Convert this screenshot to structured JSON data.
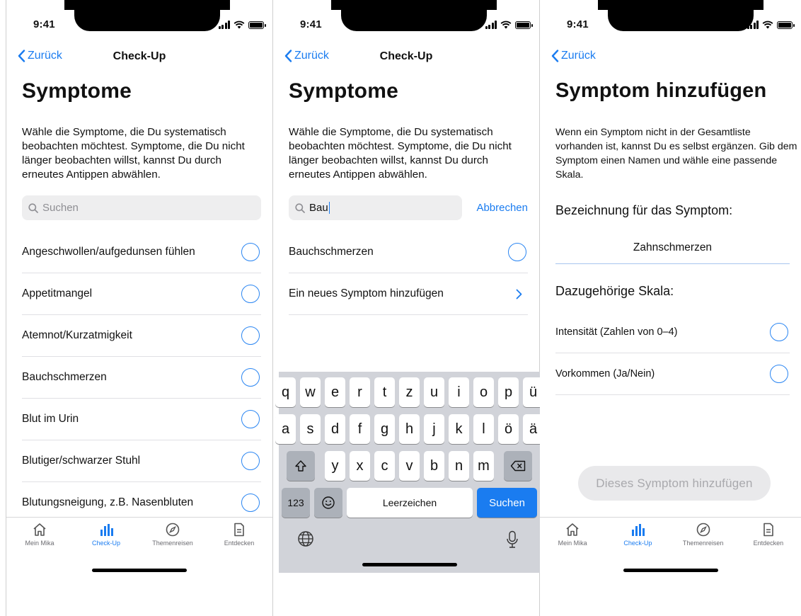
{
  "status": {
    "time": "9:41"
  },
  "screen1": {
    "back_label": "Zurück",
    "nav_title": "Check-Up",
    "title": "Symptome",
    "description": "Wähle die Symptome, die Du systematisch beobachten möchtest. Symptome, die Du nicht länger beobachten willst, kannst Du durch erneutes Antippen abwählen.",
    "search_placeholder": "Suchen",
    "items": [
      {
        "label": "Angeschwollen/aufgedunsen fühlen"
      },
      {
        "label": "Appetitmangel"
      },
      {
        "label": "Atemnot/Kurzatmigkeit"
      },
      {
        "label": "Bauchschmerzen"
      },
      {
        "label": "Blut im Urin"
      },
      {
        "label": "Blutiger/schwarzer Stuhl"
      },
      {
        "label": "Blutungsneigung, z.B. Nasenbluten"
      }
    ]
  },
  "screen2": {
    "back_label": "Zurück",
    "nav_title": "Check-Up",
    "title": "Symptome",
    "description": "Wähle die Symptome, die Du systematisch beobachten möchtest. Symptome, die Du nicht länger beobachten willst, kannst Du durch erneutes Antippen abwählen.",
    "search_value": "Bau",
    "cancel_label": "Abbrechen",
    "result_item": "Bauchschmerzen",
    "add_new_item": "Ein neues Symptom hinzufügen",
    "keyboard": {
      "row1": [
        "q",
        "w",
        "e",
        "r",
        "t",
        "z",
        "u",
        "i",
        "o",
        "p",
        "ü"
      ],
      "row2": [
        "a",
        "s",
        "d",
        "f",
        "g",
        "h",
        "j",
        "k",
        "l",
        "ö",
        "ä"
      ],
      "row3": [
        "y",
        "x",
        "c",
        "v",
        "b",
        "n",
        "m"
      ],
      "numbers_key": "123",
      "space_key": "Leerzeichen",
      "search_key": "Suchen"
    }
  },
  "screen3": {
    "back_label": "Zurück",
    "title": "Symptom hinzufügen",
    "description": "Wenn ein Symptom nicht in der Gesamtliste vorhanden ist, kannst Du es selbst ergänzen. Gib dem Symptom einen Namen und wähle eine passende Skala.",
    "name_label": "Bezeichnung für das Symptom:",
    "name_value": "Zahnschmerzen",
    "scale_label": "Dazugehörige Skala:",
    "scales": [
      {
        "label": "Intensität (Zahlen von 0–4)"
      },
      {
        "label": "Vorkommen (Ja/Nein)"
      }
    ],
    "add_button": "Dieses Symptom hinzufügen"
  },
  "tabbar": {
    "tabs": [
      {
        "label": "Mein Mika",
        "icon": "home-icon",
        "active": false
      },
      {
        "label": "Check-Up",
        "icon": "bar-chart-icon",
        "active": true
      },
      {
        "label": "Themenreisen",
        "icon": "compass-icon",
        "active": false
      },
      {
        "label": "Entdecken",
        "icon": "document-icon",
        "active": false
      }
    ]
  },
  "colors": {
    "accent": "#1a7cf0",
    "radio": "#2b86f2",
    "disabled_button": "#e9e9eb"
  }
}
